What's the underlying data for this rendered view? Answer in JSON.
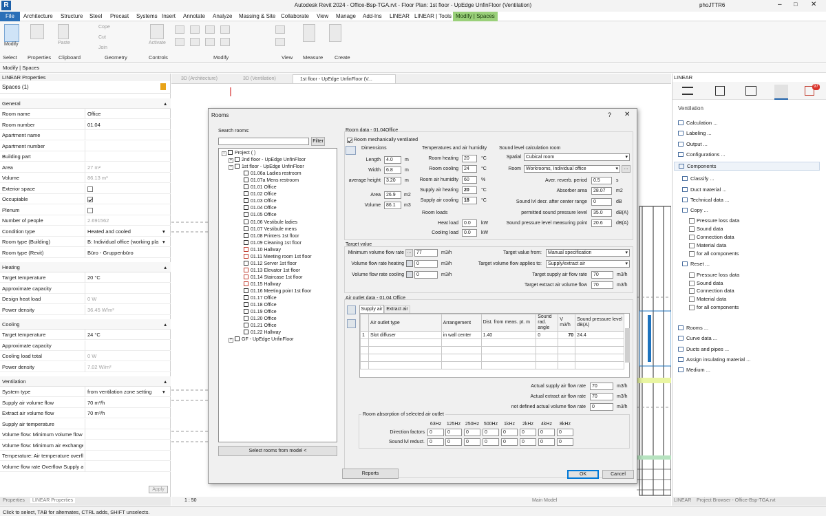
{
  "app": {
    "title": "Autodesk Revit 2024 - Office-Bsp-TGA.rvt - Floor Plan: 1st floor - UpEdge UnfinFloor (Ventilation)",
    "logo": "R",
    "user": "phoJTTR6"
  },
  "menu": {
    "tabs": [
      "File",
      "Architecture",
      "Structure",
      "Steel",
      "Precast",
      "Systems",
      "Insert",
      "Annotate",
      "Analyze",
      "Massing & Site",
      "Collaborate",
      "View",
      "Manage",
      "Add-Ins",
      "LINEAR",
      "LINEAR | Tools",
      "Modify | Spaces"
    ]
  },
  "ribbon": {
    "groups": [
      "Select",
      "Properties",
      "Clipboard",
      "Geometry",
      "Controls",
      "Modify",
      "View",
      "Measure",
      "Create"
    ],
    "buttons": {
      "modify": "Modify",
      "paste": "Paste",
      "cope": "Cope",
      "cut": "Cut",
      "join": "Join",
      "activate": "Activate",
      "properties": "Properties"
    }
  },
  "context_bar": "Modify | Spaces",
  "left_panel": {
    "header": "LINEAR Properties",
    "type_selector": "Spaces (1)",
    "sections": {
      "general": "General",
      "heating": "Heating",
      "cooling": "Cooling",
      "ventilation": "Ventilation"
    },
    "general_rows": [
      {
        "k": "Room name",
        "v": "Office"
      },
      {
        "k": "Room number",
        "v": "01.04"
      },
      {
        "k": "Apartment name",
        "v": ""
      },
      {
        "k": "Apartment number",
        "v": ""
      },
      {
        "k": "Building part",
        "v": ""
      },
      {
        "k": "Area",
        "v": "27 m²"
      },
      {
        "k": "Volume",
        "v": "86.13 m³"
      },
      {
        "k": "Exterior space",
        "v": ""
      },
      {
        "k": "Occupiable",
        "v": ""
      },
      {
        "k": "Plenum",
        "v": ""
      },
      {
        "k": "Number of people",
        "v": "2.691562"
      },
      {
        "k": "Condition type",
        "v": "Heated and cooled"
      },
      {
        "k": "Room type (Building)",
        "v": "B: Individual office (working pla"
      },
      {
        "k": "Room type (Revit)",
        "v": "Büro - Gruppenbüro"
      }
    ],
    "heating_rows": [
      {
        "k": "Target temperature",
        "v": "20 °C"
      },
      {
        "k": "Approximate capacity",
        "v": ""
      },
      {
        "k": "Design heat load",
        "v": "0 W"
      },
      {
        "k": "Power density",
        "v": "36.45 W/m²"
      }
    ],
    "cooling_rows": [
      {
        "k": "Target temperature",
        "v": "24 °C"
      },
      {
        "k": "Approximate capacity",
        "v": ""
      },
      {
        "k": "Cooling load total",
        "v": "0 W"
      },
      {
        "k": "Power density",
        "v": "7.02 W/m²"
      }
    ],
    "ventilation_rows": [
      {
        "k": "System type",
        "v": "from ventilation zone setting"
      },
      {
        "k": "Supply air volume flow",
        "v": "70 m³/h"
      },
      {
        "k": "Extract air volume flow",
        "v": "70 m³/h"
      },
      {
        "k": "Supply air temperature",
        "v": ""
      },
      {
        "k": "Volume flow: Minimum volume flow",
        "v": ""
      },
      {
        "k": "Volume flow: Minimum air exchange",
        "v": ""
      },
      {
        "k": "Temperature: Air temperature overfl",
        "v": ""
      },
      {
        "k": "Volume flow rate Overflow Supply a",
        "v": ""
      }
    ],
    "apply_label": "Apply",
    "bottom_tabs": [
      "Properties",
      "LINEAR Properties"
    ]
  },
  "view_tabs": [
    "3D (Architecture)",
    "3D (Ventilation)",
    "1st floor - UpEdge UnfinFloor (V..."
  ],
  "view_bar": {
    "scale": "1 : 50",
    "model": "Main Model"
  },
  "status_text": "Click to select, TAB for alternates, CTRL adds, SHIFT unselects.",
  "right_panel": {
    "header": "LINEAR",
    "badge": "97",
    "section_title": "Ventilation",
    "items_a": [
      "Calculation ...",
      "Labeling ...",
      "Output ...",
      "Configurations ..."
    ],
    "components": "Components",
    "items_b": [
      "Classify ...",
      "Duct material ...",
      "Technical data ..."
    ],
    "copy": "Copy ...",
    "copy_opts": [
      "Pressure loss data",
      "Sound data",
      "Connection data",
      "Material data",
      "for all components"
    ],
    "reset": "Reset ...",
    "reset_opts": [
      "Pressure loss data",
      "Sound data",
      "Connection data",
      "Material data",
      "for all components"
    ],
    "items_c": [
      "Rooms ...",
      "Curve data ...",
      "Ducts and pipes ...",
      "Assign insulating material ...",
      "Medium ..."
    ],
    "bottom_tabs": [
      "LINEAR",
      "Project Browser - Office-Bsp-TGA.rvt"
    ]
  },
  "dialog": {
    "title": "Rooms",
    "help": "?",
    "close": "✕",
    "search_label": "Search rooms:",
    "filter_btn": "Filter",
    "tree": {
      "project": "Project ( )",
      "floor2": "2nd floor - UpEdge UnfinFloor",
      "floor1": "1st floor - UpEdge UnfinFloor",
      "rooms": [
        "01.06a Ladies restroom",
        "01.07a Mens restroom",
        "01.01 Office",
        "01.02 Office",
        "01.03 Office",
        "01.04 Office",
        "01.05 Office",
        "01.06 Vestibule ladies",
        "01.07 Vestibule mens",
        "01.08 Printers 1st floor",
        "01.09 Cleaning 1st floor",
        "01.10 Hallway",
        "01.11 Meeting room 1st floor",
        "01.12 Server 1st floor",
        "01.13 Elevator 1st floor",
        "01.14 Staircase 1st floor",
        "01.15 Hallway",
        "01.16 Meeting point 1st floor",
        "01.17 Office",
        "01.18 Office",
        "01.19 Office",
        "01.20 Office",
        "01.21 Office",
        "01.22 Hallway"
      ],
      "gf": "GF - UpEdge UnfinFloor"
    },
    "select_model_btn": "Select rooms from model <",
    "room_data_title": "Room data - 01.04Office",
    "mech_vent": "Room mechanically ventilated",
    "dims": {
      "title": "Dimensions",
      "length_lbl": "Length",
      "length": "4.0",
      "length_u": "m",
      "width_lbl": "Width",
      "width": "6.8",
      "width_u": "m",
      "height_lbl": "average height",
      "height": "3.20",
      "height_u": "m",
      "area_lbl": "Area",
      "area": "26.9",
      "area_u": "m2",
      "volume_lbl": "Volume",
      "volume": "86.1",
      "volume_u": "m3"
    },
    "temps": {
      "title": "Temperatures and air humidity",
      "rh_lbl": "Room heating",
      "rh": "20",
      "rh_u": "°C",
      "rc_lbl": "Room cooling",
      "rc": "24",
      "rc_u": "°C",
      "hum_lbl": "Room air humidity",
      "hum": "60",
      "hum_u": "%",
      "sah_lbl": "Supply air heating",
      "sah": "20",
      "sah_u": "°C",
      "sac_lbl": "Supply air cooling",
      "sac": "18",
      "sac_u": "°C"
    },
    "loads": {
      "title": "Room loads",
      "heat_lbl": "Heat load",
      "heat": "0.0",
      "heat_u": "kW",
      "cool_lbl": "Cooling load",
      "cool": "0.0",
      "cool_u": "kW"
    },
    "sound": {
      "title": "Sound level calculation room",
      "spatial_lbl": "Spatial",
      "spatial": "Cubical room",
      "room_lbl": "Room",
      "room": "Workrooms, Individual office",
      "rev_lbl": "Aver. reverb. period",
      "rev": "0.5",
      "rev_u": "s",
      "abs_lbl": "Absorber area",
      "abs": "28.07",
      "abs_u": "m2",
      "decr_lbl": "Sound lvl decr. after center range",
      "decr": "0",
      "decr_u": "dB",
      "perm_lbl": "permitted sound pressure level",
      "perm": "35.0",
      "perm_u": "dB(A)",
      "meas_lbl": "Sound pressure level measuring point",
      "meas": "20.6",
      "meas_u": "dB(A)"
    },
    "target": {
      "title": "Target value",
      "min_lbl": "Minimum volume flow rate",
      "min": "77",
      "min_u": "m3/h",
      "heat_lbl": "Volume flow rate heating",
      "heat": "0",
      "heat_u": "m3/h",
      "cool_lbl": "Volume flow rate cooling",
      "cool": "0",
      "cool_u": "m3/h",
      "from_lbl": "Target value from:",
      "from": "Manual specification",
      "applies_lbl": "Target volume flow applies to:",
      "applies": "Supply/extract air",
      "sup_lbl": "Target supply air flow rate",
      "sup": "70",
      "sup_u": "m3/h",
      "ext_lbl": "Target extract air volume flow",
      "ext": "70",
      "ext_u": "m3/h"
    },
    "outlet": {
      "title": "Air outlet data - 01.04 Office",
      "tabs": [
        "Supply air",
        "Extract air"
      ],
      "headers": [
        "",
        "Air outlet type",
        "Arrangement",
        "Dist. from meas. pt. m",
        "Sound rad. angle",
        "V m3/h",
        "Sound pressure level dB(A)"
      ],
      "row": {
        "n": "1",
        "type": "Slot diffuser",
        "arr": "in wall center",
        "dist": "1.40",
        "angle": "0",
        "v": "70",
        "spl": "24.4"
      }
    },
    "actual": {
      "sup_lbl": "Actual supply air flow rate",
      "sup": "70",
      "sup_u": "m3/h",
      "ext_lbl": "Actual extract air flow rate",
      "ext": "70",
      "ext_u": "m3/h",
      "nd_lbl": "not defined actual volume flow rate",
      "nd": "0",
      "nd_u": "m3/h"
    },
    "absorption": {
      "title": "Room absorption of selected air outlet",
      "freqs": [
        "63Hz",
        "125Hz",
        "250Hz",
        "500Hz",
        "1kHz",
        "2kHz",
        "4kHz",
        "8kHz"
      ],
      "dir_lbl": "Direction factors",
      "red_lbl": "Sound lvl reduct.",
      "dir": [
        "0",
        "0",
        "0",
        "0",
        "0",
        "0",
        "0",
        "0"
      ],
      "red": [
        "0",
        "0",
        "0",
        "0",
        "0",
        "0",
        "0",
        "0"
      ]
    },
    "reports_btn": "Reports",
    "ok_btn": "OK",
    "cancel_btn": "Cancel"
  },
  "colors": {
    "file_tab": "#2a6fb8",
    "context_tab": "#9ad07a",
    "revit_blue": "#1c5fa8",
    "badge": "#d9332b"
  }
}
